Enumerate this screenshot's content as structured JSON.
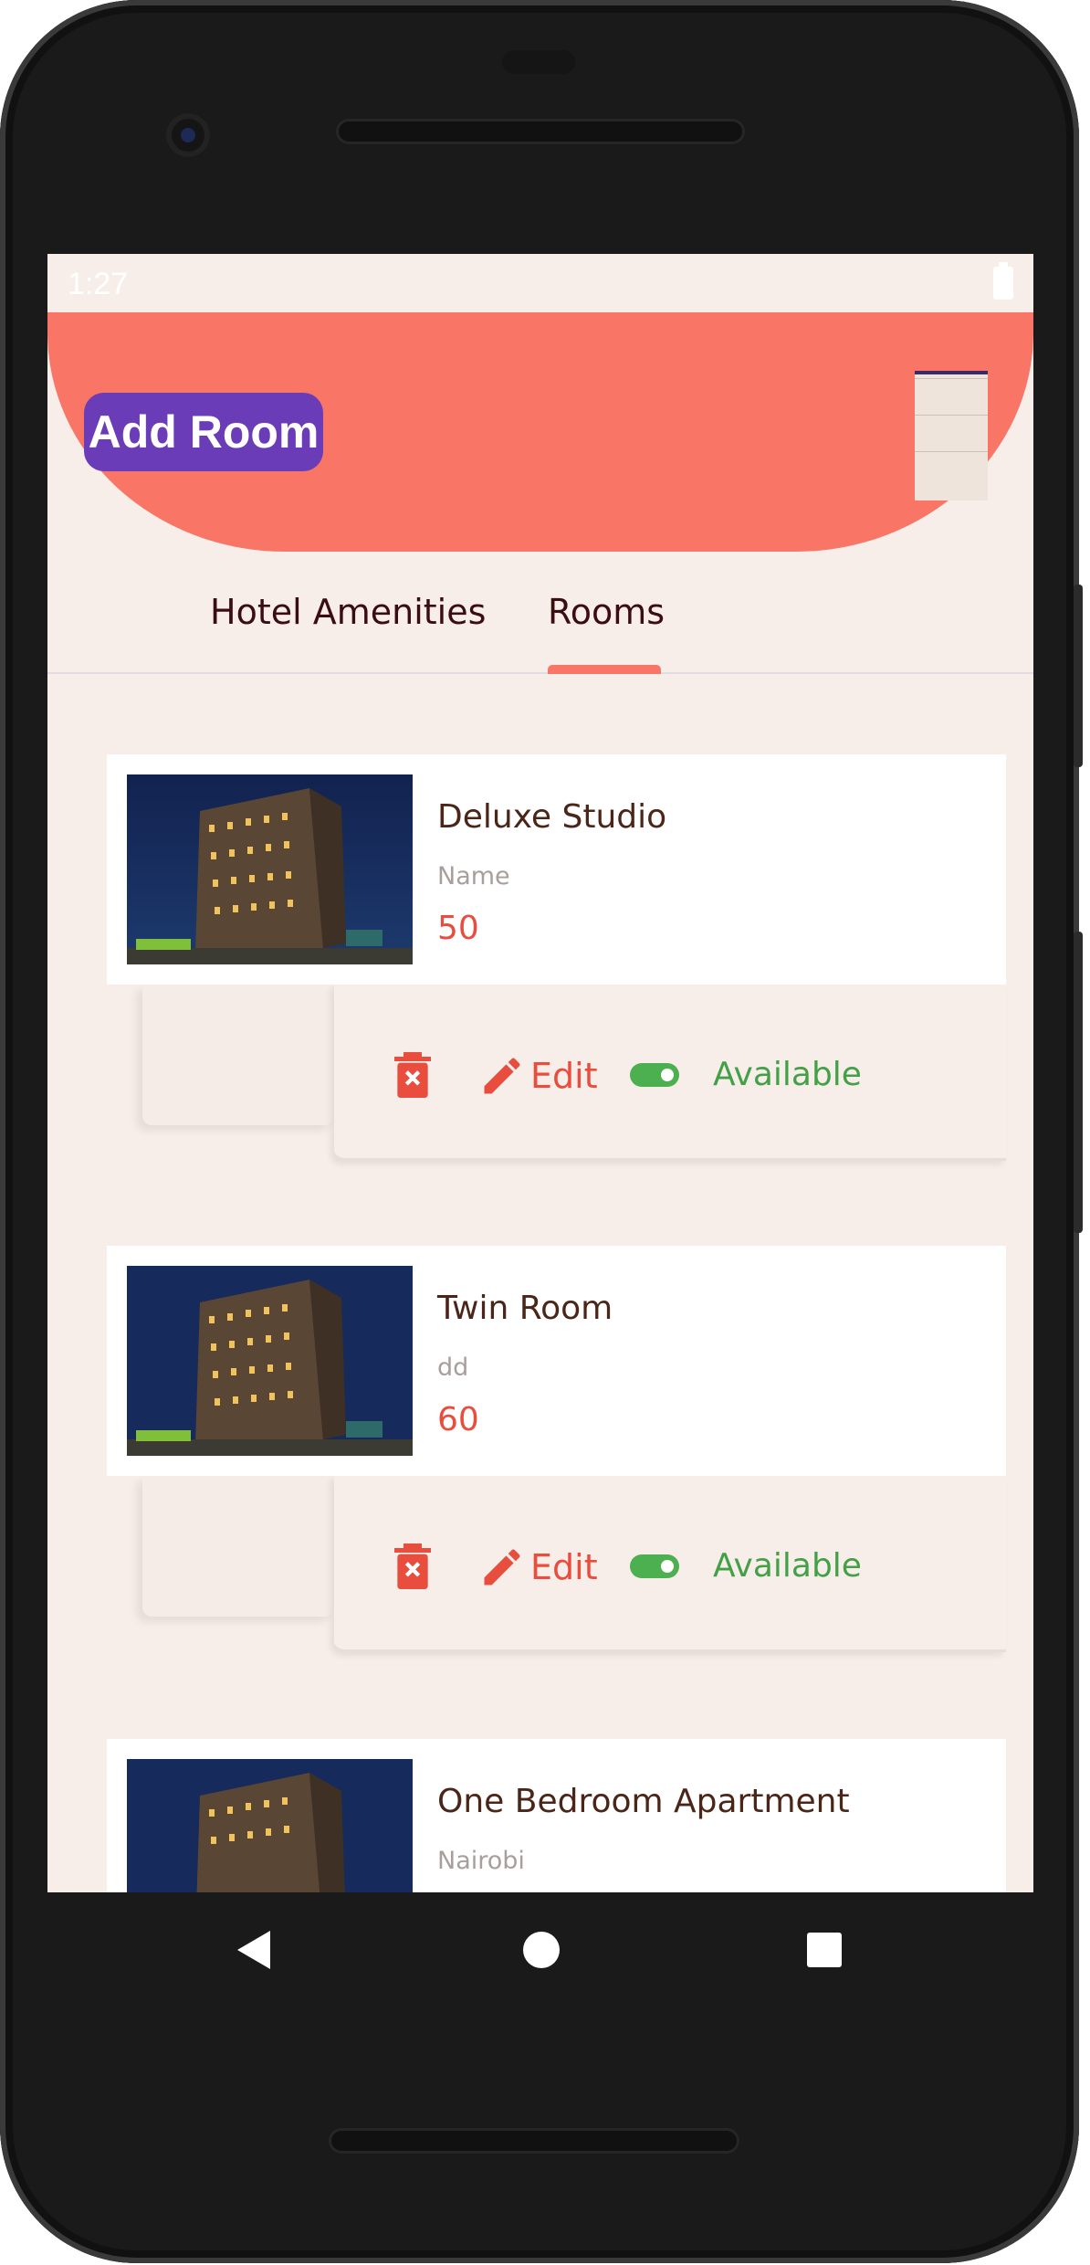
{
  "status_bar": {
    "time": "1:27"
  },
  "header": {
    "add_room_label": "Add Room"
  },
  "tabs": [
    {
      "label": "Hotel Amenities",
      "selected": false
    },
    {
      "label": "Rooms",
      "selected": true
    }
  ],
  "rooms": [
    {
      "name": "Deluxe Studio",
      "description": "Name",
      "price": "50",
      "edit_label": "Edit",
      "status_label": "Available",
      "available": true
    },
    {
      "name": "Twin Room",
      "description": "dd",
      "price": "60",
      "edit_label": "Edit",
      "status_label": "Available",
      "available": true
    },
    {
      "name": "One Bedroom Apartment",
      "description": "Nairobi",
      "price": "",
      "edit_label": "",
      "status_label": "",
      "available": true
    }
  ],
  "colors": {
    "header": "#f97565",
    "button": "#6a3cb8",
    "accent": "#e84d3d",
    "available": "#43a047",
    "background": "#f7eeea"
  },
  "icons": [
    "battery-icon",
    "menu-icon",
    "delete-icon",
    "edit-icon",
    "toggle-icon",
    "back-icon",
    "home-icon",
    "recents-icon"
  ]
}
